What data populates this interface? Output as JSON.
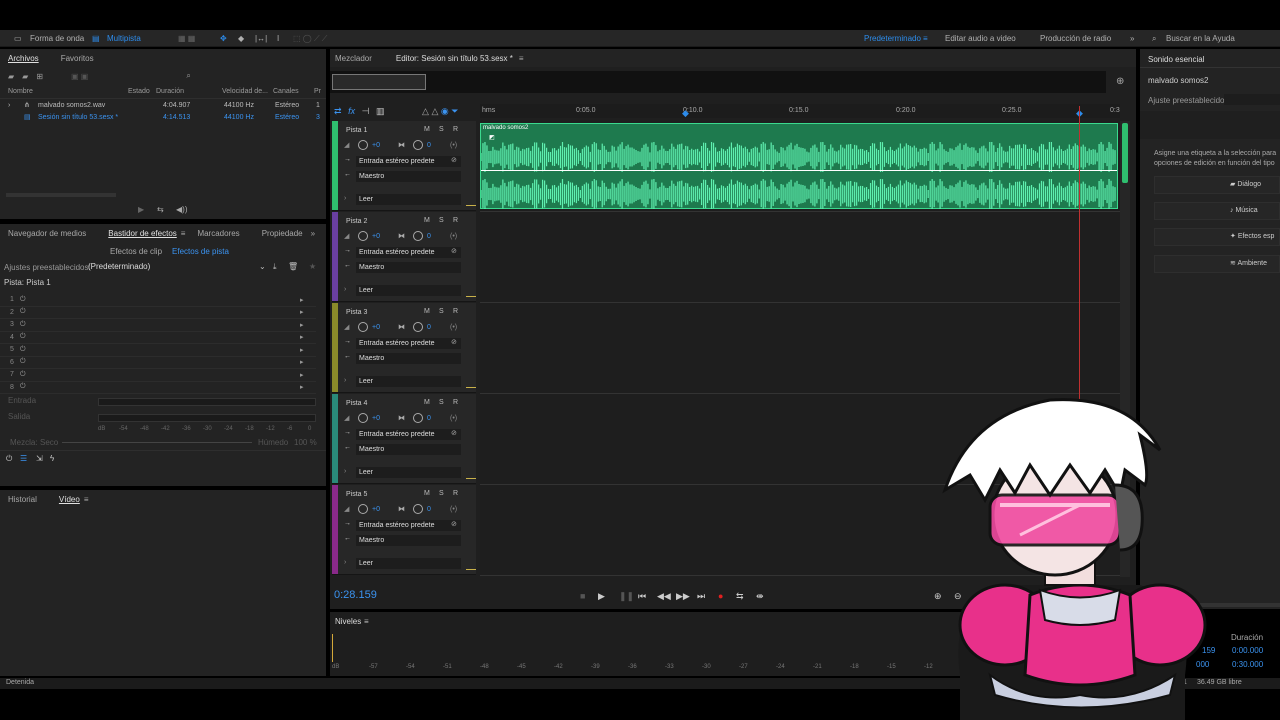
{
  "topbar": {
    "waveform": "Forma de onda",
    "multitrack": "Multipista",
    "workspaces": [
      "Predeterminado",
      "Editar audio a video",
      "Producción de radio"
    ],
    "search_placeholder": "Buscar en la Ayuda"
  },
  "files_panel": {
    "tabs": [
      "Archivos",
      "Favoritos"
    ],
    "columns": [
      "Nombre",
      "Estado",
      "Duración",
      "Velocidad de...",
      "Canales",
      "Pr"
    ],
    "rows": [
      {
        "name": "malvado somos2.wav",
        "duration": "4:04.907",
        "rate": "44100 Hz",
        "channels": "Estéreo",
        "pr": "1"
      },
      {
        "name": "Sesión sin título 53.sesx *",
        "duration": "4:14.513",
        "rate": "44100 Hz",
        "channels": "Estéreo",
        "pr": "3"
      }
    ]
  },
  "effects_panel": {
    "tabs": [
      "Navegador de medios",
      "Bastidor de efectos",
      "Marcadores",
      "Propiedade"
    ],
    "subtabs": [
      "Efectos de clip",
      "Efectos de pista"
    ],
    "presets_label": "Ajustes preestablecidos:",
    "presets_value": "(Predeterminado)",
    "track_label": "Pista: Pista 1",
    "slots": [
      "1",
      "2",
      "3",
      "4",
      "5",
      "6",
      "7",
      "8"
    ],
    "input_label": "Entrada",
    "output_label": "Salida",
    "mix_label": "Mezcla:",
    "dry_label": "Seco",
    "wet_label": "Húmedo",
    "wet_value": "100 %",
    "db_ticks": [
      "dB",
      "-54",
      "-48",
      "-42",
      "-36",
      "-30",
      "-24",
      "-18",
      "-12",
      "-6",
      "0"
    ]
  },
  "bottom_panel": {
    "tabs": [
      "Historial",
      "Vídeo"
    ]
  },
  "editor": {
    "tabs": [
      "Mezclador",
      "Editor: Sesión sin título 53.sesx *"
    ],
    "ruler": [
      "hms",
      "0:05.0",
      "0:10.0",
      "0:15.0",
      "0:20.0",
      "0:25.0",
      "0:3"
    ],
    "clip_name": "malvado somos2",
    "time": "0:28.159",
    "tracks": [
      {
        "name": "Pista 1",
        "color": "#2fbf6f",
        "input": "Entrada estéreo predete",
        "output": "Maestro",
        "mode": "Leer"
      },
      {
        "name": "Pista 2",
        "color": "#6a3fa0",
        "input": "Entrada estéreo predete",
        "output": "Maestro",
        "mode": "Leer"
      },
      {
        "name": "Pista 3",
        "color": "#8a8a2a",
        "input": "Entrada estéreo predete",
        "output": "Maestro",
        "mode": "Leer"
      },
      {
        "name": "Pista 4",
        "color": "#2a8a7a",
        "input": "Entrada estéreo predete",
        "output": "Maestro",
        "mode": "Leer"
      },
      {
        "name": "Pista 5",
        "color": "#8a2a8a",
        "input": "Entrada estéreo predete",
        "output": "Maestro",
        "mode": "Leer"
      }
    ],
    "vol": "+0",
    "pan": "0",
    "msr": [
      "M",
      "S",
      "R"
    ]
  },
  "levels": {
    "title": "Niveles",
    "ticks": [
      "dB",
      "-57",
      "-54",
      "-51",
      "-48",
      "-45",
      "-42",
      "-39",
      "-36",
      "-33",
      "-30",
      "-27",
      "-24",
      "-21",
      "-18",
      "-15",
      "-12"
    ]
  },
  "essential_sound": {
    "title": "Sonido esencial",
    "file": "malvado somos2",
    "preset_label": "Ajuste preestablecido:",
    "hint": "Asigne una etiqueta a la selección para opciones de edición en función del tipo",
    "buttons": [
      "Diálogo",
      "Música",
      "Efectos esp",
      "Ambiente"
    ]
  },
  "selection": {
    "duration_label": "Duración",
    "values": [
      "0:00.000",
      "0:30.000"
    ],
    "left_vals": [
      "159",
      "000"
    ]
  },
  "status": {
    "left": "Detenida",
    "right": "36.49 GB libre",
    "mid": "1"
  }
}
